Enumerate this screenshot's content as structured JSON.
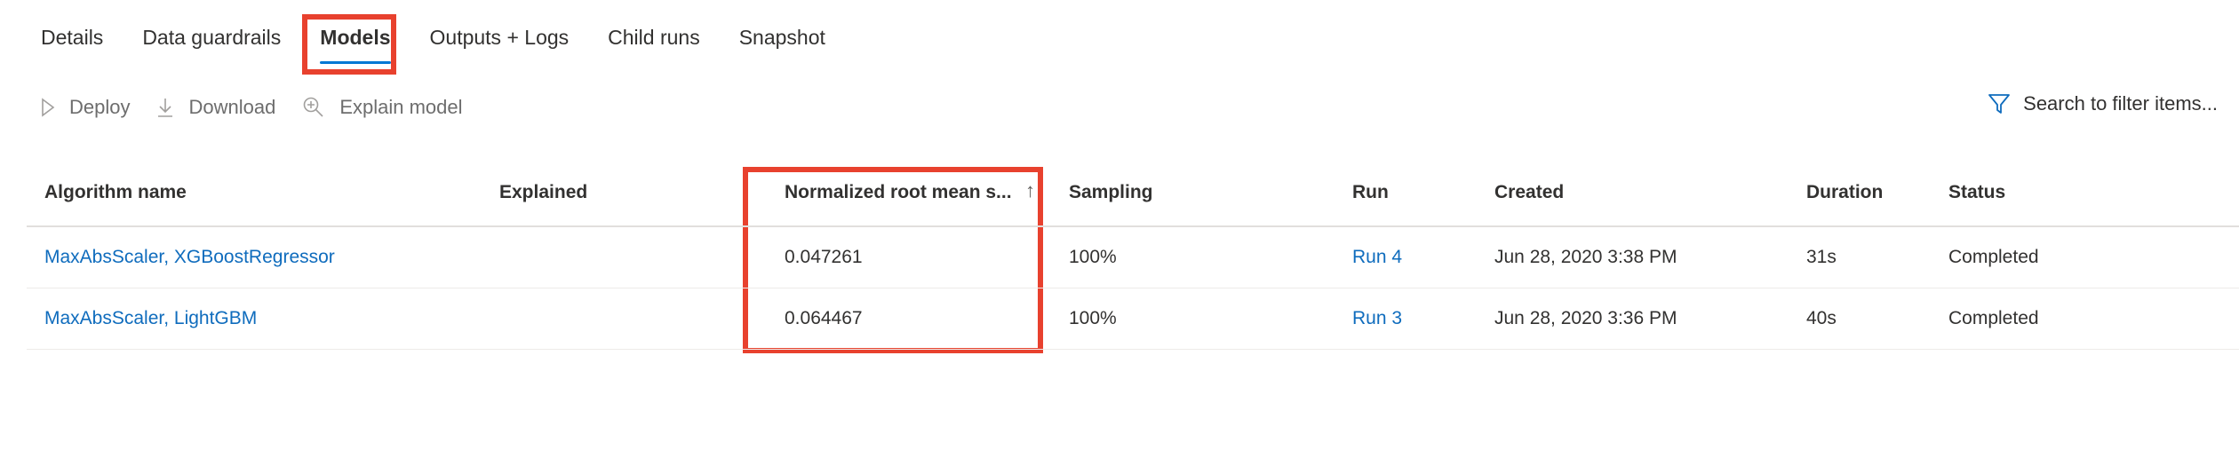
{
  "tabs": [
    {
      "label": "Details"
    },
    {
      "label": "Data guardrails"
    },
    {
      "label": "Models",
      "selected": true
    },
    {
      "label": "Outputs + Logs"
    },
    {
      "label": "Child runs"
    },
    {
      "label": "Snapshot"
    }
  ],
  "toolbar": {
    "deploy_label": "Deploy",
    "download_label": "Download",
    "explain_label": "Explain model",
    "deploy_icon": "play-icon",
    "download_icon": "download-icon",
    "explain_icon": "zoom-in-icon"
  },
  "filter": {
    "label": "Search to filter items...",
    "icon": "filter-icon"
  },
  "table": {
    "columns": [
      "Algorithm name",
      "Explained",
      "Normalized root mean s...",
      "Sampling",
      "Run",
      "Created",
      "Duration",
      "Status"
    ],
    "sort_indicator": "↑",
    "rows": [
      {
        "algorithm": "MaxAbsScaler, XGBoostRegressor",
        "explained": "",
        "nrmse": "0.047261",
        "sampling": "100%",
        "run": "Run 4",
        "created": "Jun 28, 2020 3:38 PM",
        "duration": "31s",
        "status": "Completed"
      },
      {
        "algorithm": "MaxAbsScaler, LightGBM",
        "explained": "",
        "nrmse": "0.064467",
        "sampling": "100%",
        "run": "Run 3",
        "created": "Jun 28, 2020 3:36 PM",
        "duration": "40s",
        "status": "Completed"
      }
    ]
  },
  "colors": {
    "accent": "#0078d4",
    "link": "#0f6cbd",
    "highlight": "#e8412e"
  }
}
